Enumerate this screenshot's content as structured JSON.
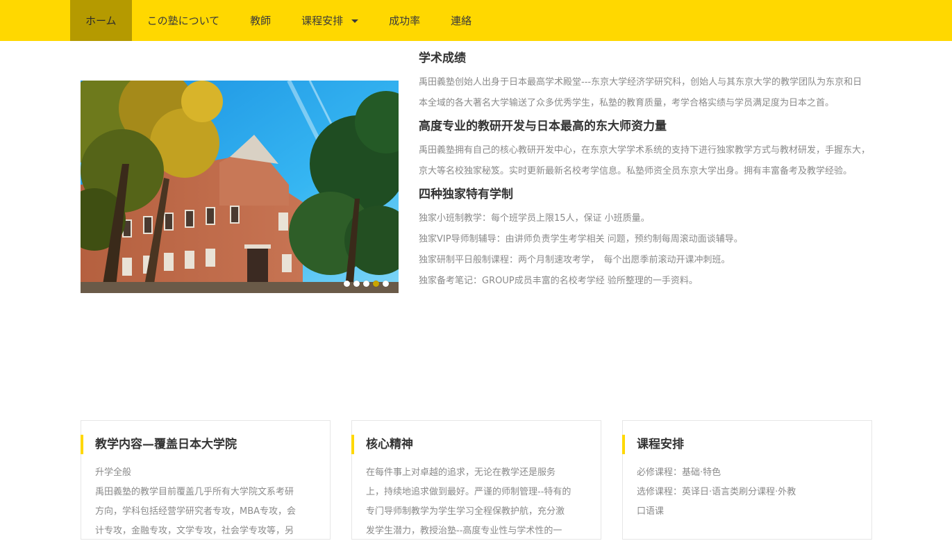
{
  "nav": {
    "items": [
      {
        "label": "ホーム"
      },
      {
        "label": "この塾について"
      },
      {
        "label": "教師"
      },
      {
        "label": "课程安排"
      },
      {
        "label": "成功率"
      },
      {
        "label": "連絡"
      }
    ]
  },
  "carousel": {
    "slide_count": 5,
    "active_index": 3,
    "accent": "#c9a400"
  },
  "intro": {
    "section1": {
      "title": "学术成绩",
      "text": "禹田義塾创始人出身于日本最高学术殿堂---东京大学经济学研究科，创始人与其东京大学的教学团队为东京和日本全域的各大著名大学输送了众多优秀学生，私塾的教育质量，考学合格实绩与学员满足度为日本之首。"
    },
    "section2": {
      "title": "高度专业的教研开发与日本最高的东大师资力量",
      "text": "禹田義塾拥有自己的核心教研开发中心，在东京大学学术系统的支持下进行独家教学方式与教材研发，手握东大，京大等名校独家秘笈。实时更新最新名校考学信息。私塾师资全员东京大学出身。拥有丰富备考及教学经验。"
    },
    "section3": {
      "title": "四种独家特有学制",
      "lines": [
        "独家小班制教学：每个班学员上限15人，保证 小班质量。",
        "独家VIP导师制辅导：由讲师负责学生考学相关 问题，预约制每周滚动面谈辅导。",
        "独家研制平日般制课程：两个月制速攻考学，　每个出愿季前滚动开课冲刺班。",
        "独家备考笔记：GROUP成员丰富的名校考学经 验所整理的一手资料。"
      ]
    }
  },
  "cards": {
    "c1": {
      "title": "教学内容—覆盖日本大学院",
      "lines": [
        "升学全般",
        "禹田義塾的教学目前覆盖几乎所有大学院文系考研",
        "方向，学科包括经营学研究者专攻，MBA专攻，会",
        "计专攻，金融专攻，文学专攻，社会学专攻等，另"
      ]
    },
    "c2": {
      "title": "核心精神",
      "lines": [
        "在每件事上对卓越的追求，无论在教学还是服务",
        "上，持续地追求做到最好。严谨的师制管理--特有的",
        "专门导师制教学为学生学习全程保教护航，充分激",
        "发学生潜力，教授治塾--高度专业性与学术性的一"
      ]
    },
    "c3": {
      "title": "课程安排",
      "lines": [
        "必修课程：基础·特色",
        "选修课程：英译日·语言类刷分课程·外教",
        "口语课"
      ]
    }
  },
  "colors": {
    "brand_yellow": "#ffd800",
    "nav_active": "#b59a00",
    "muted_text": "#8a8a8a"
  }
}
